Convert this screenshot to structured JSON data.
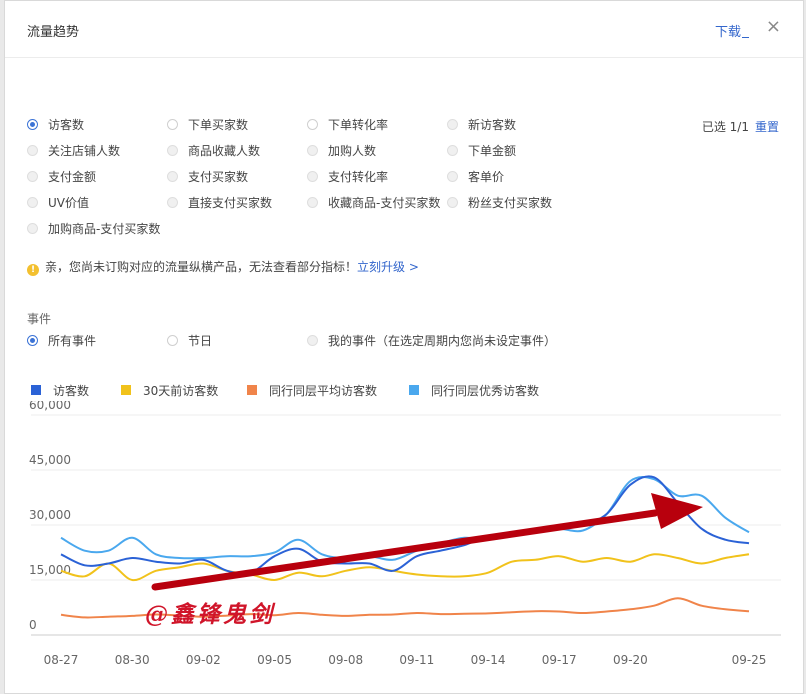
{
  "header": {
    "title": "流量趋势",
    "download": "下载",
    "close": "×"
  },
  "metrics": [
    {
      "label": "访客数",
      "state": "checked"
    },
    {
      "label": "下单买家数",
      "state": "unchecked"
    },
    {
      "label": "下单转化率",
      "state": "unchecked"
    },
    {
      "label": "新访客数",
      "state": "disabled"
    },
    {
      "label": "关注店铺人数",
      "state": "disabled"
    },
    {
      "label": "商品收藏人数",
      "state": "disabled"
    },
    {
      "label": "加购人数",
      "state": "disabled"
    },
    {
      "label": "下单金额",
      "state": "disabled"
    },
    {
      "label": "支付金额",
      "state": "disabled"
    },
    {
      "label": "支付买家数",
      "state": "disabled"
    },
    {
      "label": "支付转化率",
      "state": "disabled"
    },
    {
      "label": "客单价",
      "state": "disabled"
    },
    {
      "label": "UV价值",
      "state": "disabled"
    },
    {
      "label": "直接支付买家数",
      "state": "disabled"
    },
    {
      "label": "收藏商品-支付买家数",
      "state": "disabled"
    },
    {
      "label": "粉丝支付买家数",
      "state": "disabled"
    },
    {
      "label": "加购商品-支付买家数",
      "state": "disabled"
    }
  ],
  "selection": {
    "text": "已选 1/1",
    "reset": "重置"
  },
  "notice": {
    "icon": "warning-icon",
    "text": "亲，您尚未订购对应的流量纵横产品，无法查看部分指标！",
    "link": "立刻升级 >"
  },
  "events": {
    "title": "事件",
    "options": [
      {
        "label": "所有事件",
        "state": "checked"
      },
      {
        "label": "节日",
        "state": "unchecked"
      },
      {
        "label": "我的事件（在选定周期内您尚未设定事件）",
        "state": "disabled"
      }
    ]
  },
  "signature": "@鑫锋鬼剑",
  "chart_data": {
    "type": "line",
    "ylim": [
      0,
      60000
    ],
    "yticks": [
      0,
      15000,
      30000,
      45000,
      60000
    ],
    "ytick_labels": [
      "0",
      "15,000",
      "30,000",
      "45,000",
      "60,000"
    ],
    "x": [
      "08-27",
      "08-28",
      "08-29",
      "08-30",
      "08-31",
      "09-01",
      "09-02",
      "09-03",
      "09-04",
      "09-05",
      "09-06",
      "09-07",
      "09-08",
      "09-09",
      "09-10",
      "09-11",
      "09-12",
      "09-13",
      "09-14",
      "09-15",
      "09-16",
      "09-17",
      "09-18",
      "09-19",
      "09-20",
      "09-21",
      "09-22",
      "09-23",
      "09-24",
      "09-25"
    ],
    "xtick_labels": [
      "08-27",
      "08-30",
      "09-02",
      "09-05",
      "09-08",
      "09-11",
      "09-14",
      "09-17",
      "09-20",
      "09-25"
    ],
    "grid": true,
    "legend_position": "top-left",
    "series": [
      {
        "name": "访客数",
        "color": "#2b62d6",
        "values": [
          22000,
          19000,
          19500,
          21000,
          20000,
          19500,
          20500,
          17500,
          17000,
          21500,
          23500,
          20000,
          19500,
          19500,
          17500,
          21500,
          23000,
          24500,
          27000,
          27000,
          28000,
          29000,
          30000,
          33000,
          41000,
          43000,
          36000,
          29000,
          26000,
          25000
        ]
      },
      {
        "name": "30天前访客数",
        "color": "#f1c21b",
        "values": [
          17500,
          16000,
          19500,
          15000,
          17500,
          18500,
          19500,
          17500,
          16500,
          15000,
          17000,
          16000,
          17500,
          18500,
          17500,
          16500,
          16000,
          16000,
          17000,
          20000,
          20500,
          21500,
          20000,
          21000,
          20000,
          22000,
          21000,
          19500,
          21000,
          22000
        ]
      },
      {
        "name": "同行同层平均访客数",
        "color": "#f0844a",
        "values": [
          5500,
          4800,
          5000,
          5200,
          5600,
          5300,
          5000,
          5300,
          5700,
          5400,
          6000,
          5500,
          5200,
          5500,
          5600,
          6000,
          5700,
          5800,
          5900,
          6200,
          6500,
          6400,
          6000,
          6400,
          7000,
          8000,
          10000,
          8000,
          7000,
          6500
        ]
      },
      {
        "name": "同行同层优秀访客数",
        "color": "#4aa8ee",
        "values": [
          26500,
          23000,
          23000,
          26500,
          22000,
          21000,
          21000,
          21500,
          21500,
          22500,
          26000,
          22000,
          21000,
          21500,
          20500,
          23000,
          25000,
          26500,
          26000,
          27000,
          28500,
          29000,
          28500,
          33000,
          42000,
          42500,
          38000,
          38000,
          32000,
          28000
        ]
      }
    ]
  }
}
